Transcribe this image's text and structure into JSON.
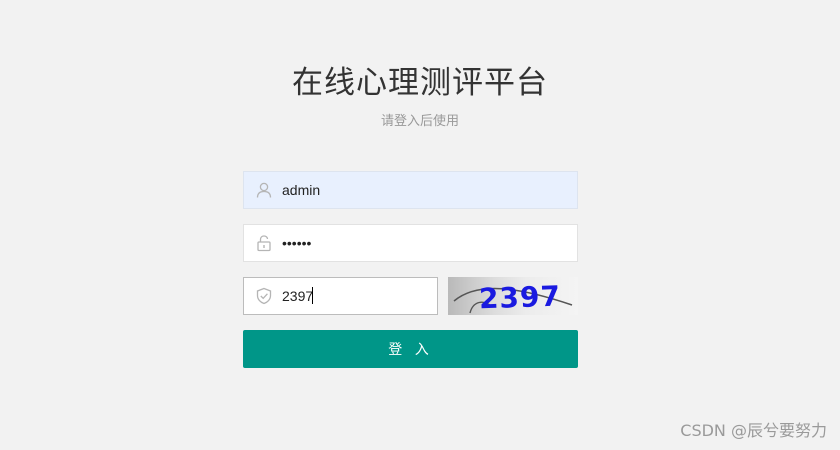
{
  "header": {
    "title": "在线心理测评平台",
    "subtitle": "请登入后使用"
  },
  "form": {
    "username": {
      "value": "admin",
      "icon": "user-icon"
    },
    "password": {
      "value": "••••••",
      "icon": "lock-icon"
    },
    "captcha": {
      "value": "2397",
      "icon": "shield-icon",
      "image_text": "2397"
    },
    "submit_label": "登 入"
  },
  "watermark": {
    "text": "CSDN @辰兮要努力"
  },
  "colors": {
    "background": "#f2f2f2",
    "primary": "#009688",
    "autofill": "#e8f0fe",
    "captcha_text": "#1a1ae0"
  }
}
